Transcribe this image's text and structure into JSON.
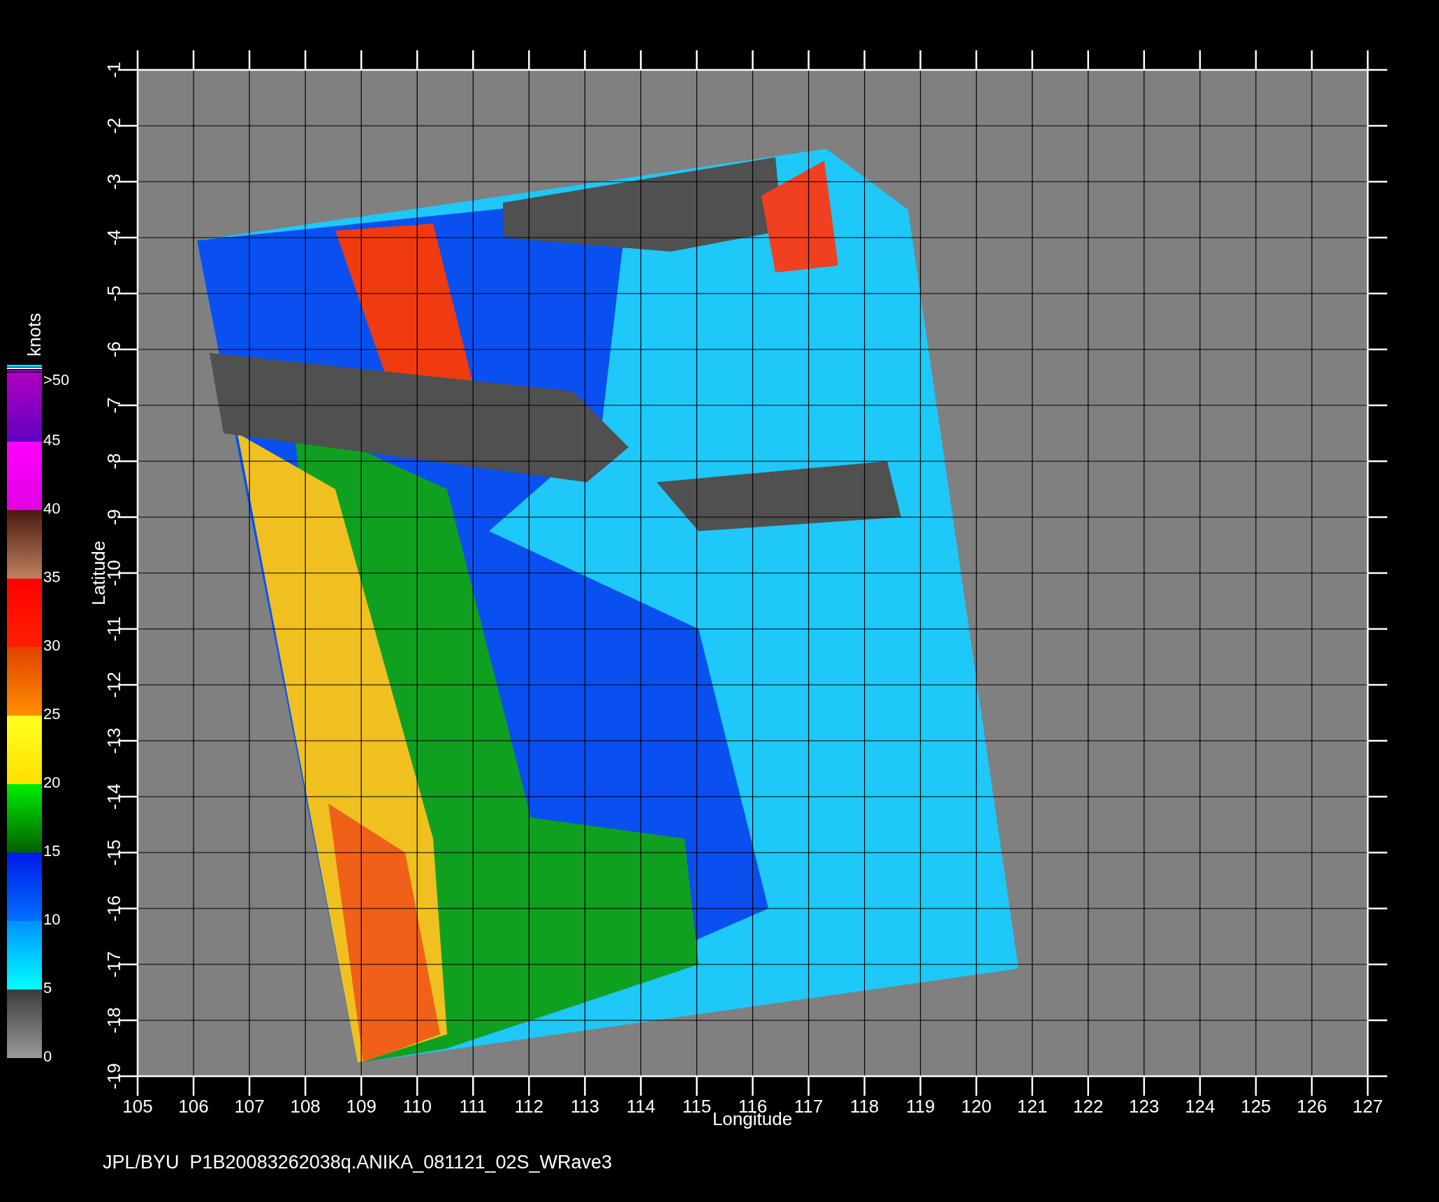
{
  "plot": {
    "x_axis": {
      "label": "Longitude",
      "ticks": [
        "105",
        "106",
        "107",
        "108",
        "109",
        "110",
        "111",
        "112",
        "113",
        "114",
        "115",
        "116",
        "117",
        "118",
        "119",
        "120",
        "121",
        "122",
        "123",
        "124",
        "125",
        "126",
        "127"
      ]
    },
    "y_axis": {
      "label": "Latitude",
      "ticks": [
        "-1",
        "-2",
        "-3",
        "-4",
        "-5",
        "-6",
        "-7",
        "-8",
        "-9",
        "-10",
        "-11",
        "-12",
        "-13",
        "-14",
        "-15",
        "-16",
        "-17",
        "-18",
        "-19"
      ]
    }
  },
  "colorbar": {
    "unit": "knots",
    "top_label": ">50",
    "labels": [
      "45",
      "40",
      "35",
      "30",
      "25",
      "20",
      "15",
      "10",
      "5",
      "0"
    ]
  },
  "footer": "JPL/BYU  P1B20083262038q.ANIKA_081121_02S_WRave3"
}
